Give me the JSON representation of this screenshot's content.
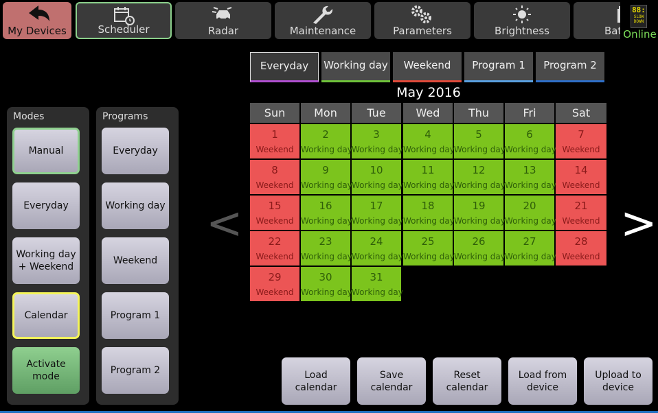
{
  "topnav": {
    "tabs": [
      {
        "label": "My Devices",
        "icon": "back-arrow-icon"
      },
      {
        "label": "Scheduler",
        "icon": "calendar-clock-icon"
      },
      {
        "label": "Radar",
        "icon": "radar-car-icon"
      },
      {
        "label": "Maintenance",
        "icon": "wrench-icon"
      },
      {
        "label": "Parameters",
        "icon": "gears-icon"
      },
      {
        "label": "Brightness",
        "icon": "sun-icon"
      },
      {
        "label": "Bat",
        "icon": "battery-icon"
      }
    ],
    "status": {
      "lcd_digits": "88:",
      "lcd_line1": "SLOW",
      "lcd_line2": "DOWN",
      "label": "Online"
    }
  },
  "modes": {
    "title": "Modes",
    "items": [
      "Manual",
      "Everyday",
      "Working day\n+ Weekend",
      "Calendar",
      "Activate\nmode"
    ]
  },
  "programs": {
    "title": "Programs",
    "items": [
      "Everyday",
      "Working day",
      "Weekend",
      "Program 1",
      "Program 2"
    ]
  },
  "filters": [
    "Everyday",
    "Working day",
    "Weekend",
    "Program 1",
    "Program 2"
  ],
  "filter_colors": [
    "#b04fd0",
    "#6fc23a",
    "#e04a3a",
    "#5aa0e0",
    "#2f6fc8"
  ],
  "calendar": {
    "month": "May 2016",
    "weekdays": [
      "Sun",
      "Mon",
      "Tue",
      "Wed",
      "Thu",
      "Fri",
      "Sat"
    ],
    "days": [
      {
        "n": "1",
        "t": "Weekend"
      },
      {
        "n": "2",
        "t": "Working day"
      },
      {
        "n": "3",
        "t": "Working day"
      },
      {
        "n": "4",
        "t": "Working day"
      },
      {
        "n": "5",
        "t": "Working day"
      },
      {
        "n": "6",
        "t": "Working day"
      },
      {
        "n": "7",
        "t": "Weekend"
      },
      {
        "n": "8",
        "t": "Weekend"
      },
      {
        "n": "9",
        "t": "Working day"
      },
      {
        "n": "10",
        "t": "Working day"
      },
      {
        "n": "11",
        "t": "Working day"
      },
      {
        "n": "12",
        "t": "Working day"
      },
      {
        "n": "13",
        "t": "Working day"
      },
      {
        "n": "14",
        "t": "Weekend"
      },
      {
        "n": "15",
        "t": "Weekend"
      },
      {
        "n": "16",
        "t": "Working day"
      },
      {
        "n": "17",
        "t": "Working day"
      },
      {
        "n": "18",
        "t": "Working day"
      },
      {
        "n": "19",
        "t": "Working day"
      },
      {
        "n": "20",
        "t": "Working day"
      },
      {
        "n": "21",
        "t": "Weekend"
      },
      {
        "n": "22",
        "t": "Weekend"
      },
      {
        "n": "23",
        "t": "Working day"
      },
      {
        "n": "24",
        "t": "Working day"
      },
      {
        "n": "25",
        "t": "Working day"
      },
      {
        "n": "26",
        "t": "Working day"
      },
      {
        "n": "27",
        "t": "Working day"
      },
      {
        "n": "28",
        "t": "Weekend"
      },
      {
        "n": "29",
        "t": "Weekend"
      },
      {
        "n": "30",
        "t": "Working day"
      },
      {
        "n": "31",
        "t": "Working day"
      }
    ],
    "prev": "<",
    "next": ">"
  },
  "actions": [
    "Load\ncalendar",
    "Save\ncalendar",
    "Reset\ncalendar",
    "Load from\ndevice",
    "Upload to\ndevice"
  ],
  "colors": {
    "weekend": "#ec5555",
    "working_day": "#7cc41d",
    "selected_mode": "#8fd08f",
    "calendar_mode": "#f3f35a",
    "online": "#7dde5a"
  }
}
